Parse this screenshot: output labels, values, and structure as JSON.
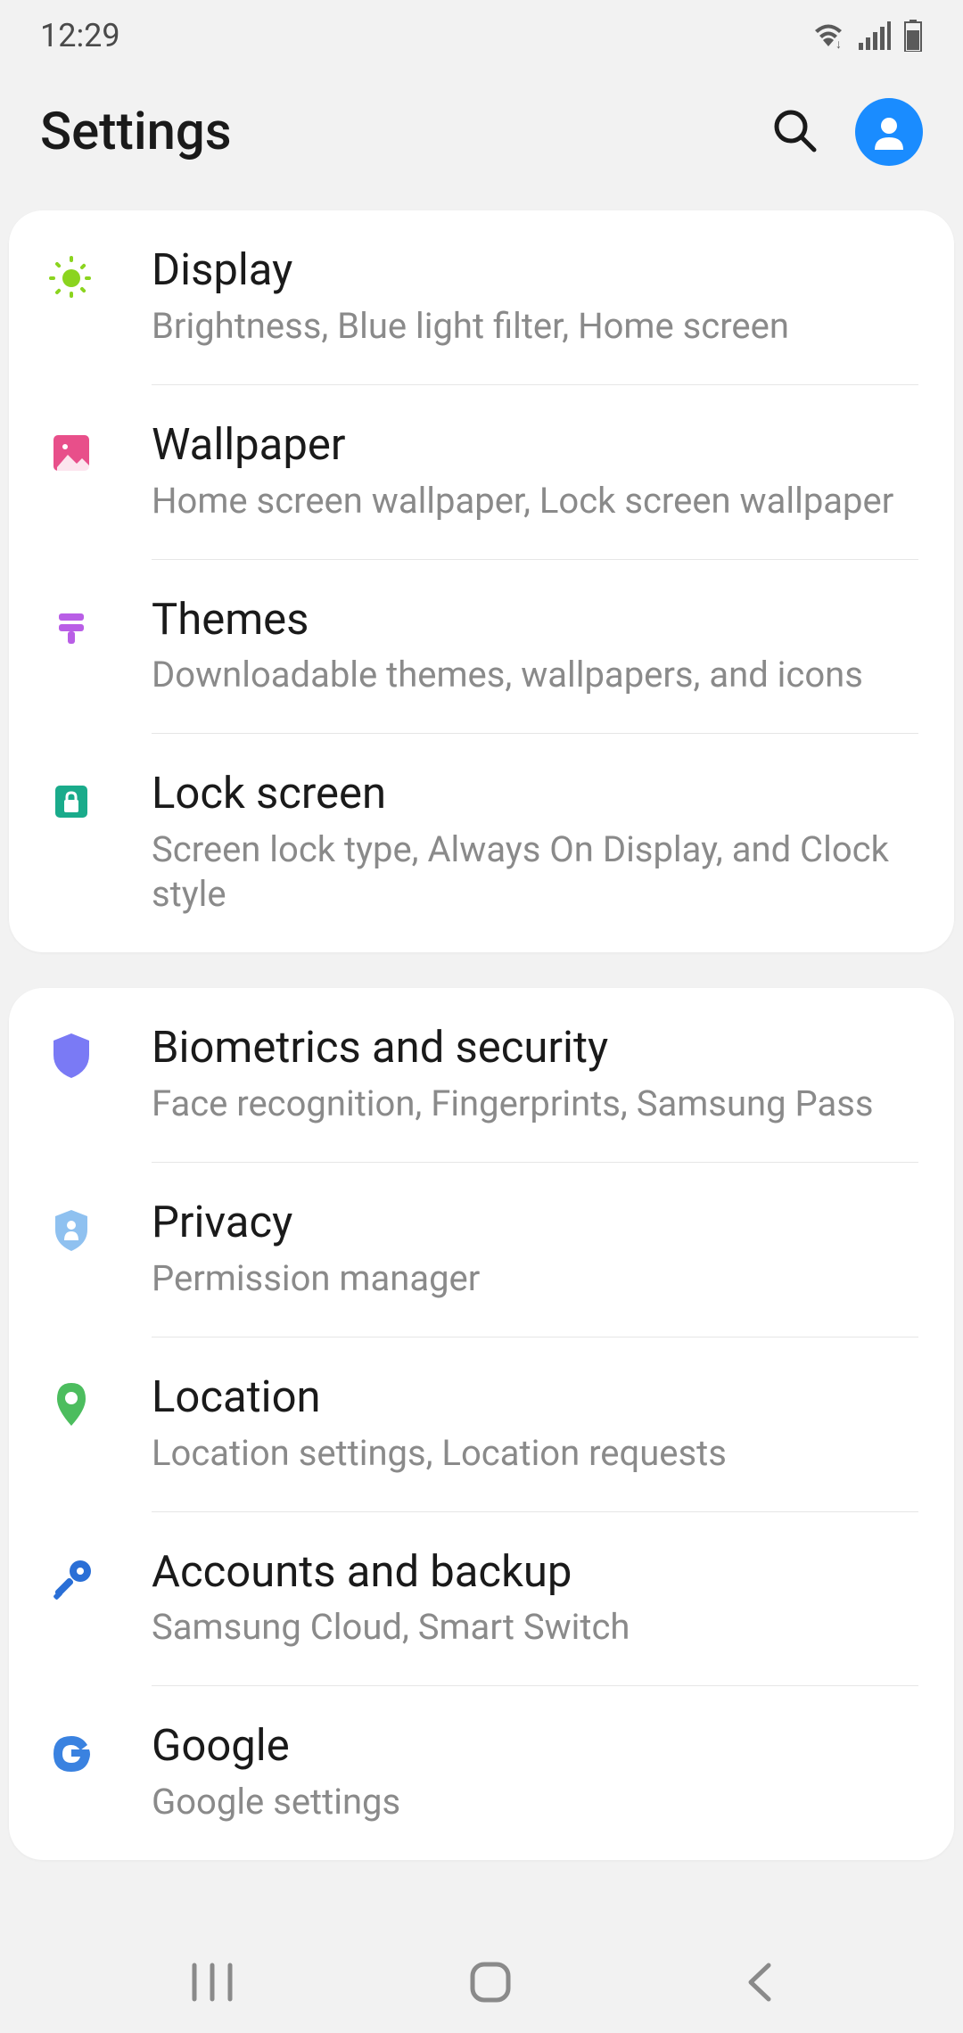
{
  "status": {
    "time": "12:29"
  },
  "header": {
    "title": "Settings"
  },
  "groups": [
    {
      "items": [
        {
          "title": "Display",
          "sub": "Brightness, Blue light filter, Home screen"
        },
        {
          "title": "Wallpaper",
          "sub": "Home screen wallpaper, Lock screen wallpaper"
        },
        {
          "title": "Themes",
          "sub": "Downloadable themes, wallpapers, and icons"
        },
        {
          "title": "Lock screen",
          "sub": "Screen lock type, Always On Display, and Clock style"
        }
      ]
    },
    {
      "items": [
        {
          "title": "Biometrics and security",
          "sub": "Face recognition, Fingerprints, Samsung Pass"
        },
        {
          "title": "Privacy",
          "sub": "Permission manager"
        },
        {
          "title": "Location",
          "sub": "Location settings, Location requests"
        },
        {
          "title": "Accounts and backup",
          "sub": "Samsung Cloud, Smart Switch"
        },
        {
          "title": "Google",
          "sub": "Google settings"
        }
      ]
    }
  ]
}
